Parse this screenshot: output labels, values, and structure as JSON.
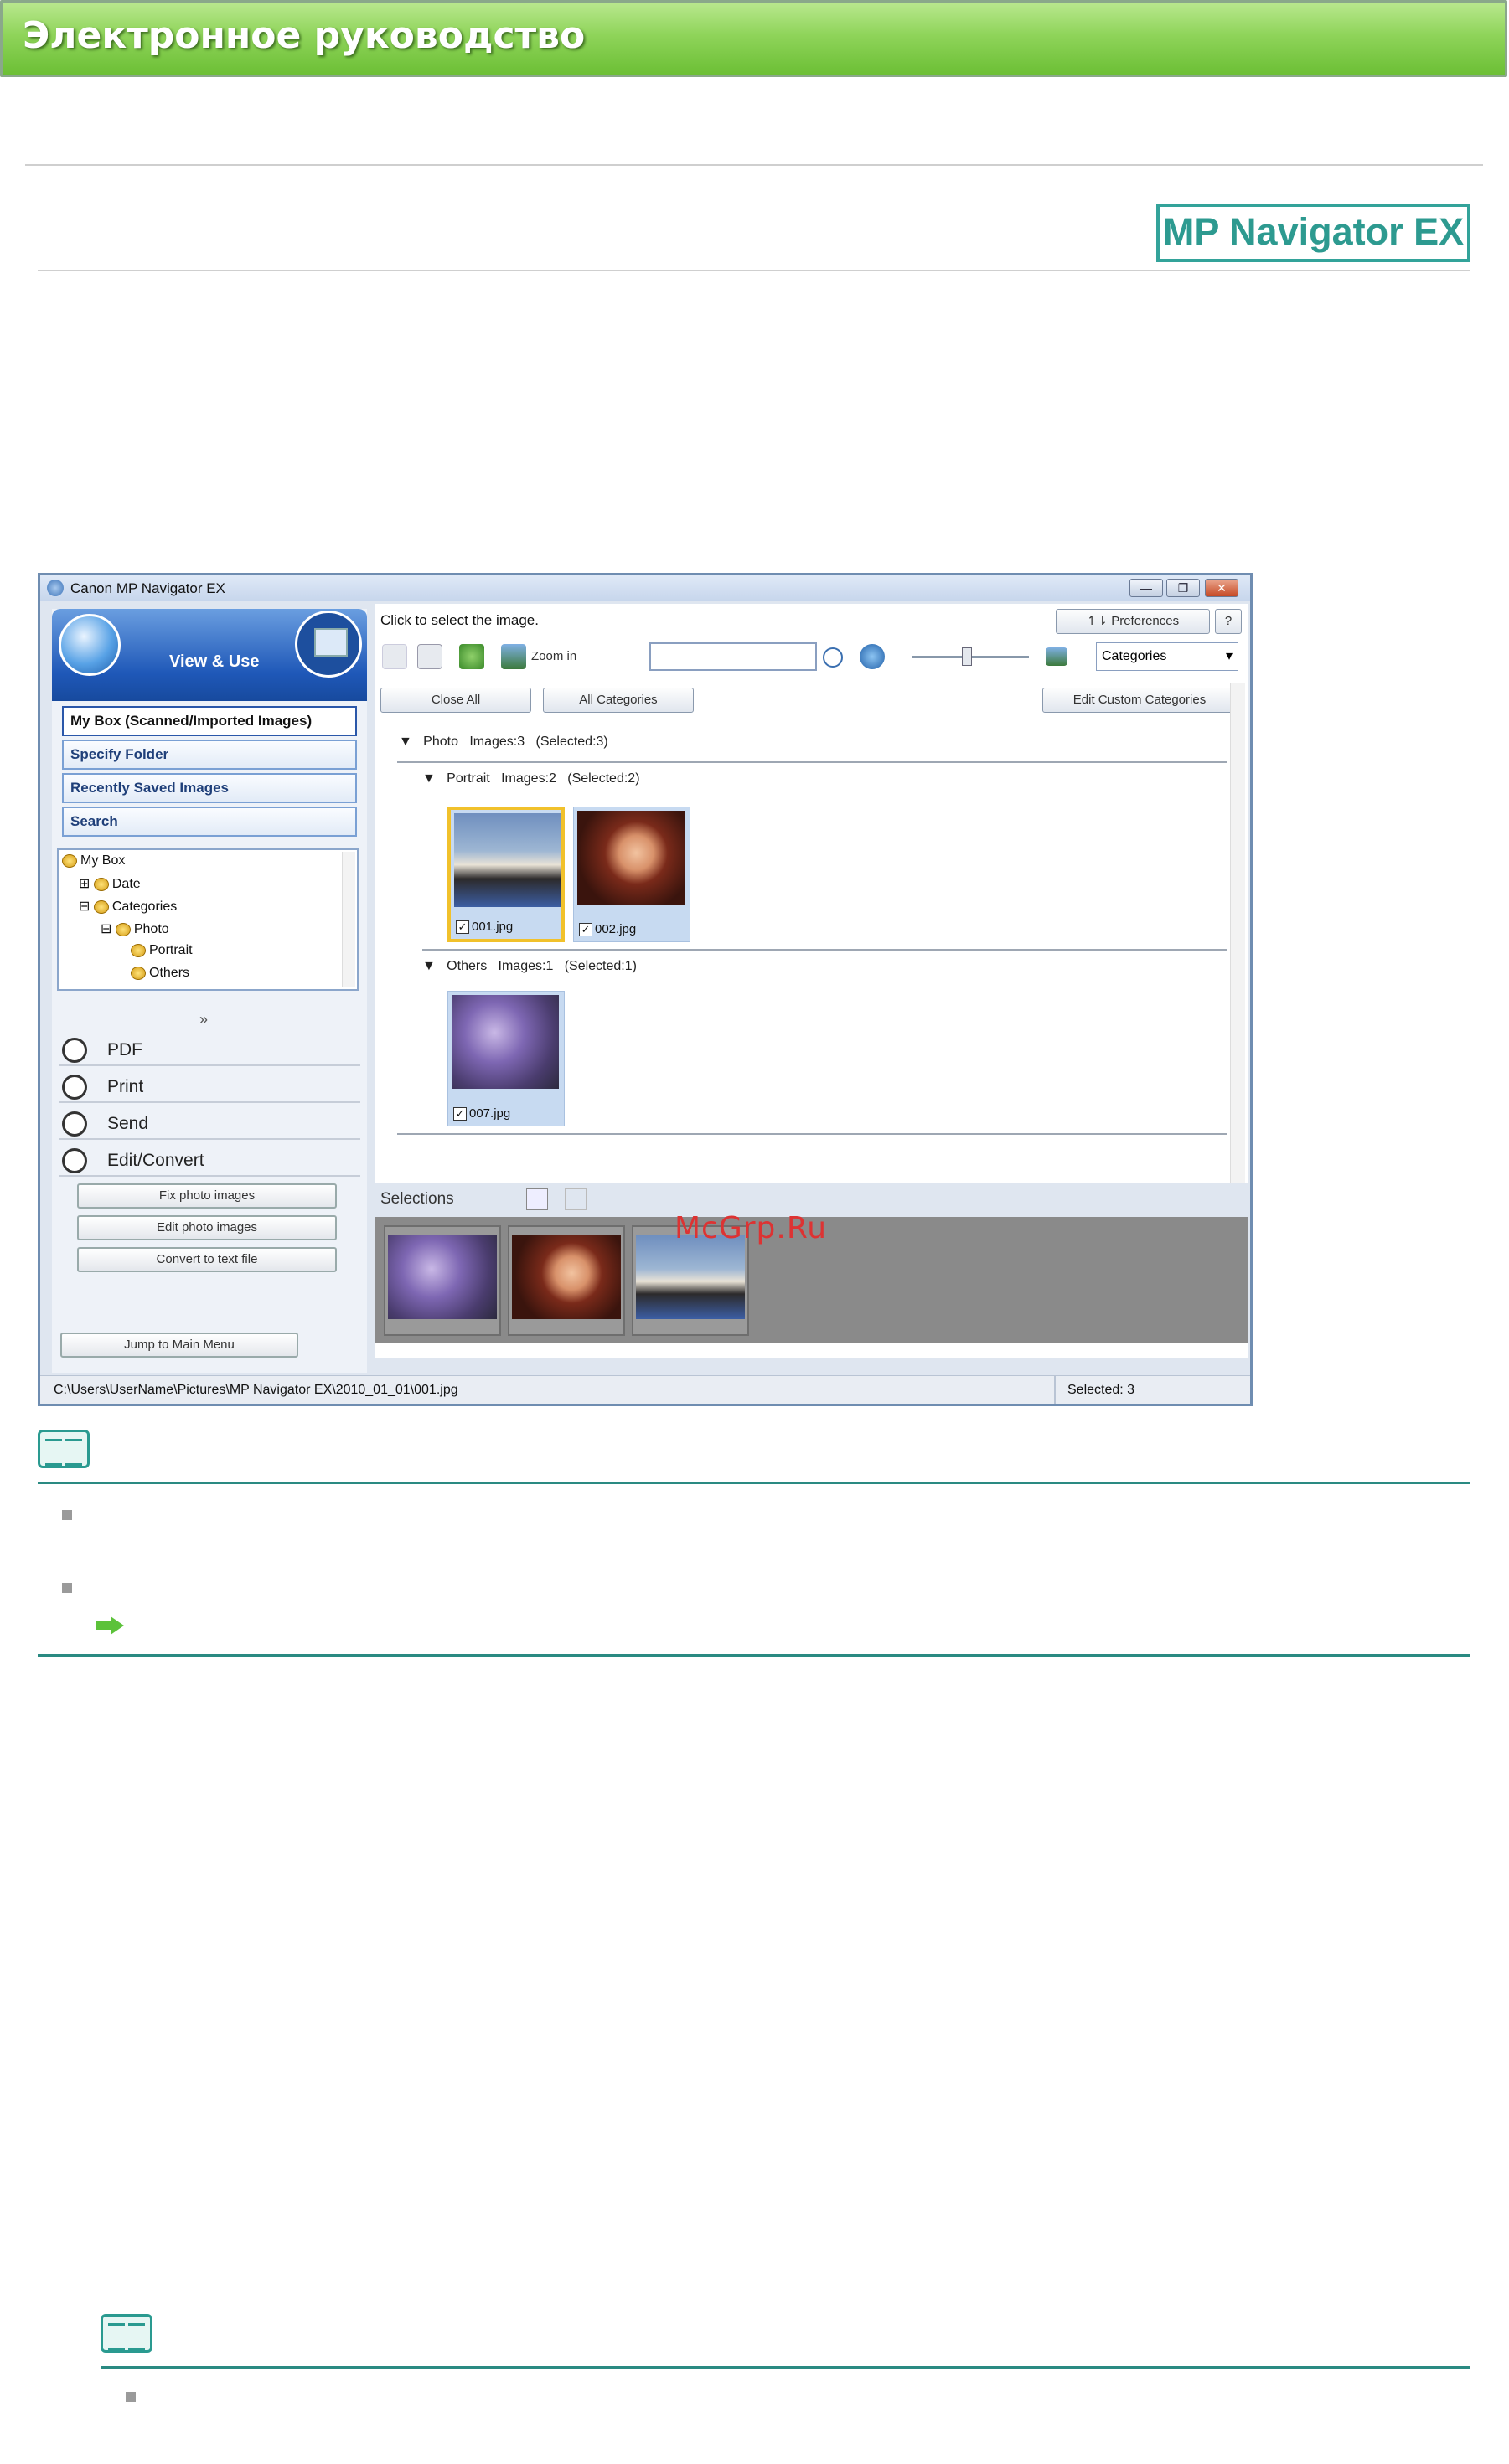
{
  "header": {
    "title": "Электронное руководство"
  },
  "logo": {
    "text": "MP Navigator EX"
  },
  "window": {
    "title": "Canon MP Navigator EX",
    "controls": [
      "minimize",
      "restore",
      "close"
    ],
    "mode_label": "View & Use",
    "left_buttons": [
      "My Box (Scanned/Imported Images)",
      "Specify Folder",
      "Recently Saved Images",
      "Search"
    ],
    "tree": [
      {
        "label": "My Box",
        "level": 0
      },
      {
        "label": "Date",
        "level": 1
      },
      {
        "label": "Categories",
        "level": 1
      },
      {
        "label": "Photo",
        "level": 2
      },
      {
        "label": "Portrait",
        "level": 3
      },
      {
        "label": "Others",
        "level": 3
      }
    ],
    "actions": [
      "PDF",
      "Print",
      "Send",
      "Edit/Convert"
    ],
    "sub_actions": [
      "Fix photo images",
      "Edit photo images",
      "Convert to text file"
    ],
    "jump_button": "Jump to Main Menu",
    "instruction": "Click to select the image.",
    "preferences": "Preferences",
    "help": "?",
    "zoom_label": "Zoom in",
    "search_value": "",
    "view_select": "Categories",
    "close_all": "Close All",
    "all_categories": "All Categories",
    "edit_custom": "Edit Custom Categories",
    "groups": {
      "photo": {
        "name": "Photo",
        "images": "Images:3",
        "selected": "(Selected:3)"
      },
      "portrait": {
        "name": "Portrait",
        "images": "Images:2",
        "selected": "(Selected:2)"
      },
      "others": {
        "name": "Others",
        "images": "Images:1",
        "selected": "(Selected:1)"
      }
    },
    "thumbs": [
      "001.jpg",
      "002.jpg",
      "007.jpg"
    ],
    "selections_label": "Selections",
    "status_path": "C:\\Users\\UserName\\Pictures\\MP Navigator EX\\2010_01_01\\001.jpg",
    "status_selected": "Selected: 3"
  },
  "watermark": "McGrp.Ru",
  "colors": {
    "header_green": "#8fd45a",
    "accent_teal": "#2a9a90",
    "window_blue": "#1f58b8"
  }
}
